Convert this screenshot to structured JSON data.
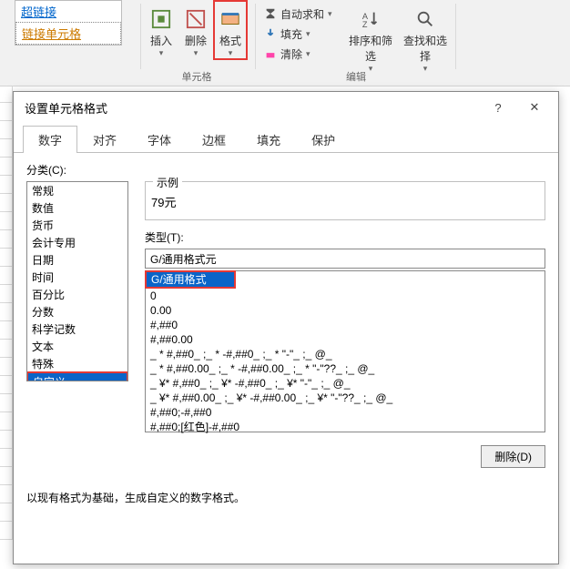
{
  "ribbon": {
    "hyperlink_items": [
      "超链接",
      "链接单元格"
    ],
    "cells_group": {
      "name": "单元格",
      "buttons": {
        "insert": "插入",
        "delete": "删除",
        "format": "格式"
      }
    },
    "editing_menu": {
      "autosum": "自动求和",
      "fill": "填充",
      "clear": "清除"
    },
    "sort_filter": "排序和筛选",
    "find_select": "查找和选择",
    "editing_group_name": "编辑"
  },
  "dialog": {
    "title": "设置单元格格式",
    "tabs": [
      "数字",
      "对齐",
      "字体",
      "边框",
      "填充",
      "保护"
    ],
    "category_label": "分类(C):",
    "categories": [
      "常规",
      "数值",
      "货币",
      "会计专用",
      "日期",
      "时间",
      "百分比",
      "分数",
      "科学记数",
      "文本",
      "特殊",
      "自定义"
    ],
    "selected_category_index": 11,
    "sample_label": "示例",
    "sample_value": "79元",
    "type_label": "类型(T):",
    "type_input_value": "G/通用格式元",
    "type_list": [
      "G/通用格式",
      "0",
      "0.00",
      "#,##0",
      "#,##0.00",
      "_ * #,##0_ ;_ * -#,##0_ ;_ * \"-\"_ ;_ @_ ",
      "_ * #,##0.00_ ;_ * -#,##0.00_ ;_ * \"-\"??_ ;_ @_ ",
      "_ ¥* #,##0_ ;_ ¥* -#,##0_ ;_ ¥* \"-\"_ ;_ @_ ",
      "_ ¥* #,##0.00_ ;_ ¥* -#,##0.00_ ;_ ¥* \"-\"??_ ;_ @_ ",
      "#,##0;-#,##0",
      "#,##0;[红色]-#,##0"
    ],
    "type_selected_index": 0,
    "delete_btn": "删除(D)",
    "note": "以现有格式为基础，生成自定义的数字格式。"
  }
}
